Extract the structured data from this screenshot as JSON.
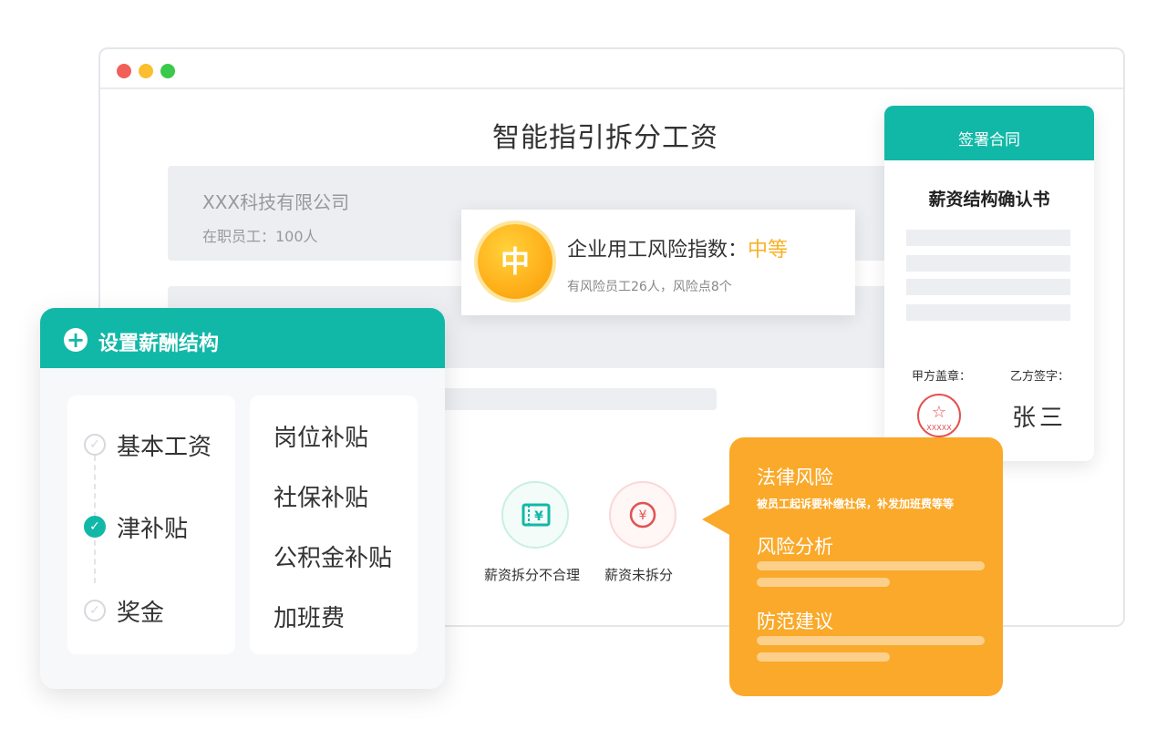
{
  "page": {
    "title": "智能指引拆分工资"
  },
  "company": {
    "name": "XXX科技有限公司",
    "staff": "在职员工：100人"
  },
  "risk": {
    "badge": "中",
    "title_prefix": "企业用工风险指数：",
    "level": "中等",
    "level_color": "#f9b125",
    "summary": "有风险员工26人，风险点8个"
  },
  "contract": {
    "header": "签署合同",
    "title": "薪资结构确认书",
    "party_a_label": "甲方盖章：",
    "party_b_label": "乙方签字：",
    "party_b_signature": "张三",
    "seal_text": "XXXXX"
  },
  "icons": {
    "unreasonable_label": "薪资拆分不合理",
    "unsplit_label": "薪资未拆分"
  },
  "salary_panel": {
    "title": "设置薪酬结构",
    "left_items": [
      {
        "label": "基本工资",
        "checked": false
      },
      {
        "label": "津补贴",
        "checked": true
      },
      {
        "label": "奖金",
        "checked": false
      }
    ],
    "right_items": [
      "岗位补贴",
      "社保补贴",
      "公积金补贴",
      "加班费"
    ]
  },
  "bubble": {
    "legal_title": "法律风险",
    "legal_desc": "被员工起诉要补缴社保，补发加班费等等",
    "analysis_title": "风险分析",
    "advice_title": "防范建议"
  },
  "colors": {
    "brand": "#12b8a7",
    "accent": "#faa92a",
    "danger": "#e35252"
  }
}
